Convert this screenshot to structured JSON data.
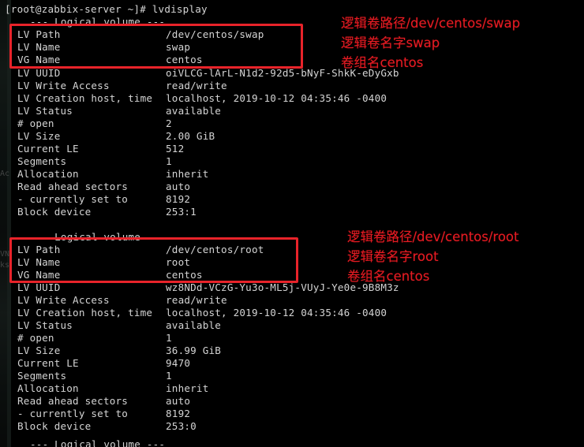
{
  "terminal": {
    "prompt_line": "[root@zabbix-server ~]# lvdisplay",
    "section_header": "--- Logical volume ---",
    "volumes": [
      {
        "lines": [
          {
            "label": "LV Path",
            "value": "/dev/centos/swap"
          },
          {
            "label": "LV Name",
            "value": "swap"
          },
          {
            "label": "VG Name",
            "value": "centos"
          },
          {
            "label": "LV UUID",
            "value": "oiVLCG-lArL-N1d2-92d5-bNyF-ShkK-eDyGxb"
          },
          {
            "label": "LV Write Access",
            "value": "read/write"
          },
          {
            "label": "LV Creation host, time",
            "value": "localhost, 2019-10-12 04:35:46 -0400"
          },
          {
            "label": "LV Status",
            "value": "available"
          },
          {
            "label": "# open",
            "value": "2"
          },
          {
            "label": "LV Size",
            "value": "2.00 GiB"
          },
          {
            "label": "Current LE",
            "value": "512"
          },
          {
            "label": "Segments",
            "value": "1"
          },
          {
            "label": "Allocation",
            "value": "inherit"
          },
          {
            "label": "Read ahead sectors",
            "value": "auto"
          },
          {
            "label": "- currently set to",
            "value": "8192"
          },
          {
            "label": "Block device",
            "value": "253:1"
          }
        ]
      },
      {
        "lines": [
          {
            "label": "LV Path",
            "value": "/dev/centos/root"
          },
          {
            "label": "LV Name",
            "value": "root"
          },
          {
            "label": "VG Name",
            "value": "centos"
          },
          {
            "label": "LV UUID",
            "value": "wz8NDd-VCzG-Yu3o-ML5j-VUyJ-Ye0e-9B8M3z"
          },
          {
            "label": "LV Write Access",
            "value": "read/write"
          },
          {
            "label": "LV Creation host, time",
            "value": "localhost, 2019-10-12 04:35:46 -0400"
          },
          {
            "label": "LV Status",
            "value": "available"
          },
          {
            "label": "# open",
            "value": "1"
          },
          {
            "label": "LV Size",
            "value": "36.99 GiB"
          },
          {
            "label": "Current LE",
            "value": "9470"
          },
          {
            "label": "Segments",
            "value": "1"
          },
          {
            "label": "Allocation",
            "value": "inherit"
          },
          {
            "label": "Read ahead sectors",
            "value": "auto"
          },
          {
            "label": "- currently set to",
            "value": "8192"
          },
          {
            "label": "Block device",
            "value": "253:0"
          }
        ]
      }
    ]
  },
  "annotations": {
    "color": "#e31c24",
    "swap": [
      "逻辑卷路径/dev/centos/swap",
      "逻辑卷名字swap",
      "卷组名centos"
    ],
    "root": [
      "逻辑卷路径/dev/centos/root",
      "逻辑卷名字root",
      "卷组名centos"
    ]
  },
  "highlights": {
    "box_color": "#e8232a",
    "boxes": [
      {
        "name": "swap-identity-box"
      },
      {
        "name": "root-identity-box"
      }
    ]
  },
  "background_ghost": {
    "fragments": [
      "Ac",
      "VN",
      "ks"
    ]
  }
}
